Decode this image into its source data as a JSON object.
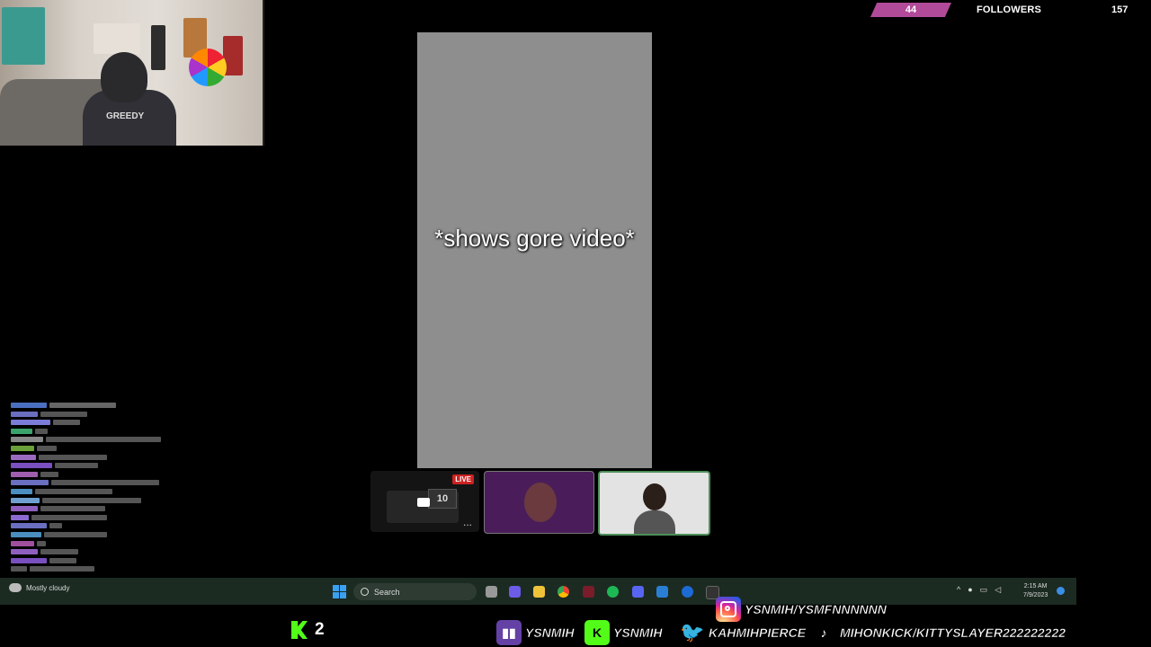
{
  "overlay": {
    "followers_count": "44",
    "followers_label": "FOLLOWERS",
    "followers_goal": "157"
  },
  "video": {
    "caption": "*shows gore video*"
  },
  "participants": {
    "tile1_badge": "LIVE",
    "tile1_screen": "10",
    "tile1_menu": "..."
  },
  "webcam": {
    "shirt_text": "GREEDY"
  },
  "taskbar": {
    "weather": "Mostly cloudy",
    "search_placeholder": "Search",
    "time": "2:15 AM",
    "date": "7/9/2023"
  },
  "social": {
    "kick_viewers": "2",
    "instagram": "YSNMIH/YSMFNNNNNN",
    "twitch": "YSNMIH",
    "kick": "YSNMIH",
    "twitter": "KAHMIHPIERCE",
    "tiktok": "MIHONKICK/KITTYSLAYER222222222"
  }
}
